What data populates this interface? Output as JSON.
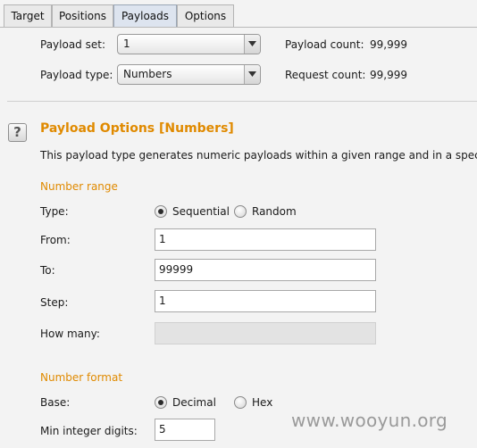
{
  "tabs": [
    {
      "label": "Target"
    },
    {
      "label": "Positions"
    },
    {
      "label": "Payloads",
      "active": true
    },
    {
      "label": "Options"
    }
  ],
  "payload_sets": {
    "set_label": "Payload set:",
    "set_value": "1",
    "type_label": "Payload type:",
    "type_value": "Numbers",
    "payload_count_label": "Payload count:",
    "payload_count": "99,999",
    "request_count_label": "Request count:",
    "request_count": "99,999"
  },
  "options": {
    "title": "Payload Options [Numbers]",
    "description": "This payload type generates numeric payloads within a given range and in a specifie",
    "number_range": {
      "heading": "Number range",
      "type_label": "Type:",
      "type_options": [
        "Sequential",
        "Random"
      ],
      "type_selected": "Sequential",
      "from_label": "From:",
      "from_value": "1",
      "to_label": "To:",
      "to_value": "99999",
      "step_label": "Step:",
      "step_value": "1",
      "how_many_label": "How many:",
      "how_many_value": ""
    },
    "number_format": {
      "heading": "Number format",
      "base_label": "Base:",
      "base_options": [
        "Decimal",
        "Hex"
      ],
      "base_selected": "Decimal",
      "min_int_label": "Min integer digits:",
      "min_int_value": "5"
    }
  },
  "watermark": "www.wooyun.org",
  "icons": {
    "help": "help-icon",
    "dropdown": "chevron-down-icon"
  },
  "colors": {
    "accent": "#e08a00",
    "active_tab": "#dde4ef"
  }
}
